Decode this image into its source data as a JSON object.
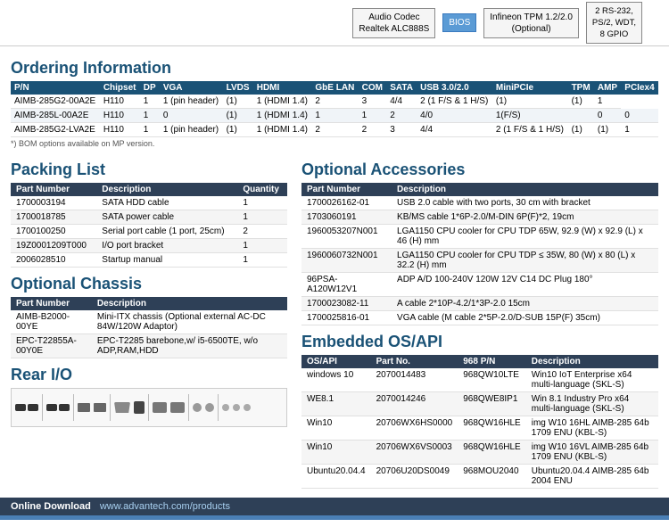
{
  "top_diagram": {
    "boxes": [
      {
        "label": "Audio Codec\nRealtek ALC888S",
        "type": "normal"
      },
      {
        "label": "BIOS",
        "type": "blue"
      },
      {
        "label": "Infineon TPM 1.2/2.0\n(Optional)",
        "type": "normal"
      }
    ],
    "right_box": "2 RS-232,\nPS/2, WDT,\n8 GPIO"
  },
  "ordering": {
    "title": "Ordering Information",
    "columns": [
      "P/N",
      "Chipset",
      "DP",
      "VGA",
      "LVDS",
      "HDMI",
      "GbE LAN",
      "COM",
      "SATA",
      "USB 3.0/2.0",
      "MiniPCIe",
      "TPM",
      "AMP",
      "PCIex4"
    ],
    "rows": [
      [
        "AIMB-285G2-00A2E",
        "H110",
        "1",
        "1 (pin header)",
        "(1)",
        "1 (HDMI 1.4)",
        "2",
        "3",
        "4/4",
        "2 (1 F/S & 1 H/S)",
        "(1)",
        "(1)",
        "1"
      ],
      [
        "AIMB-285L-00A2E",
        "H110",
        "1",
        "0",
        "(1)",
        "1 (HDMI 1.4)",
        "1",
        "1",
        "2",
        "4/0",
        "1(F/S)",
        "",
        "0",
        "0"
      ],
      [
        "AIMB-285G2-LVA2E",
        "H110",
        "1",
        "1 (pin header)",
        "(1)",
        "1 (HDMI 1.4)",
        "2",
        "2",
        "3",
        "4/4",
        "2 (1 F/S & 1 H/S)",
        "(1)",
        "(1)",
        "1"
      ]
    ],
    "note": "*) BOM options available on MP version."
  },
  "packing": {
    "title": "Packing List",
    "columns": [
      "Part Number",
      "Description",
      "Quantity"
    ],
    "rows": [
      [
        "1700003194",
        "SATA HDD cable",
        "1"
      ],
      [
        "1700018785",
        "SATA power cable",
        "1"
      ],
      [
        "1700100250",
        "Serial port cable (1 port, 25cm)",
        "2"
      ],
      [
        "19Z0001209T000",
        "I/O port bracket",
        "1"
      ],
      [
        "2006028510",
        "Startup manual",
        "1"
      ]
    ]
  },
  "optional_chassis": {
    "title": "Optional Chassis",
    "columns": [
      "Part Number",
      "Description"
    ],
    "rows": [
      [
        "AIMB-B2000-00YE",
        "Mini-ITX chassis (Optional external AC-DC 84W/120W Adaptor)"
      ],
      [
        "EPC-T22855A-00Y0E",
        "EPC-T2285 barebone,w/ i5-6500TE, w/o ADP,RAM,HDD"
      ]
    ]
  },
  "rear_io": {
    "title": "Rear I/O"
  },
  "optional_accessories": {
    "title": "Optional Accessories",
    "columns": [
      "Part Number",
      "Description"
    ],
    "rows": [
      [
        "1700026162-01",
        "USB 2.0 cable with two ports, 30 cm with bracket"
      ],
      [
        "1703060191",
        "KB/MS cable 1*6P-2.0/M-DIN 6P(F)*2, 19cm"
      ],
      [
        "1960053207N001",
        "LGA1150 CPU cooler for CPU TDP 65W,\n92.9 (W) x 92.9 (L) x 46 (H) mm"
      ],
      [
        "1960060732N001",
        "LGA1150 CPU cooler for CPU TDP ≤ 35W,\n80 (W) x 80 (L) x 32.2 (H) mm"
      ],
      [
        "96PSA-A120W12V1",
        "ADP A/D 100-240V 120W 12V C14 DC Plug 180°"
      ],
      [
        "1700023082-11",
        "A cable 2*10P-4.2/1*3P-2.0 15cm"
      ],
      [
        "1700025816-01",
        "VGA cable (M cable 2*5P-2.0/D-SUB 15P(F) 35cm)"
      ]
    ]
  },
  "embedded_os": {
    "title": "Embedded OS/API",
    "columns": [
      "OS/API",
      "Part No.",
      "968 P/N",
      "Description"
    ],
    "rows": [
      [
        "windows 10",
        "2070014483",
        "968QW10LTE",
        "Win10 IoT Enterprise x64 multi-language (SKL-S)"
      ],
      [
        "WE8.1",
        "2070014246",
        "968QWE8IP1",
        "Win 8.1 Industry Pro x64 multi-language (SKL-S)"
      ],
      [
        "Win10",
        "20706WX6HS0000",
        "968QW16HLE",
        "img W10 16HL AIMB-285 64b 1709 ENU (KBL-S)"
      ],
      [
        "Win10",
        "20706WX6VS0003",
        "968QW16HLE",
        "img W10 16VL AIMB-285 64b 1709 ENU (KBL-S)"
      ],
      [
        "Ubuntu20.04.4",
        "20706U20DS0049",
        "968MOU2040",
        "Ubuntu20.04.4 AIMB-285 64b 2004 ENU"
      ]
    ]
  },
  "download_bar": {
    "label": "Online Download",
    "url": "www.advantech.com/products"
  }
}
